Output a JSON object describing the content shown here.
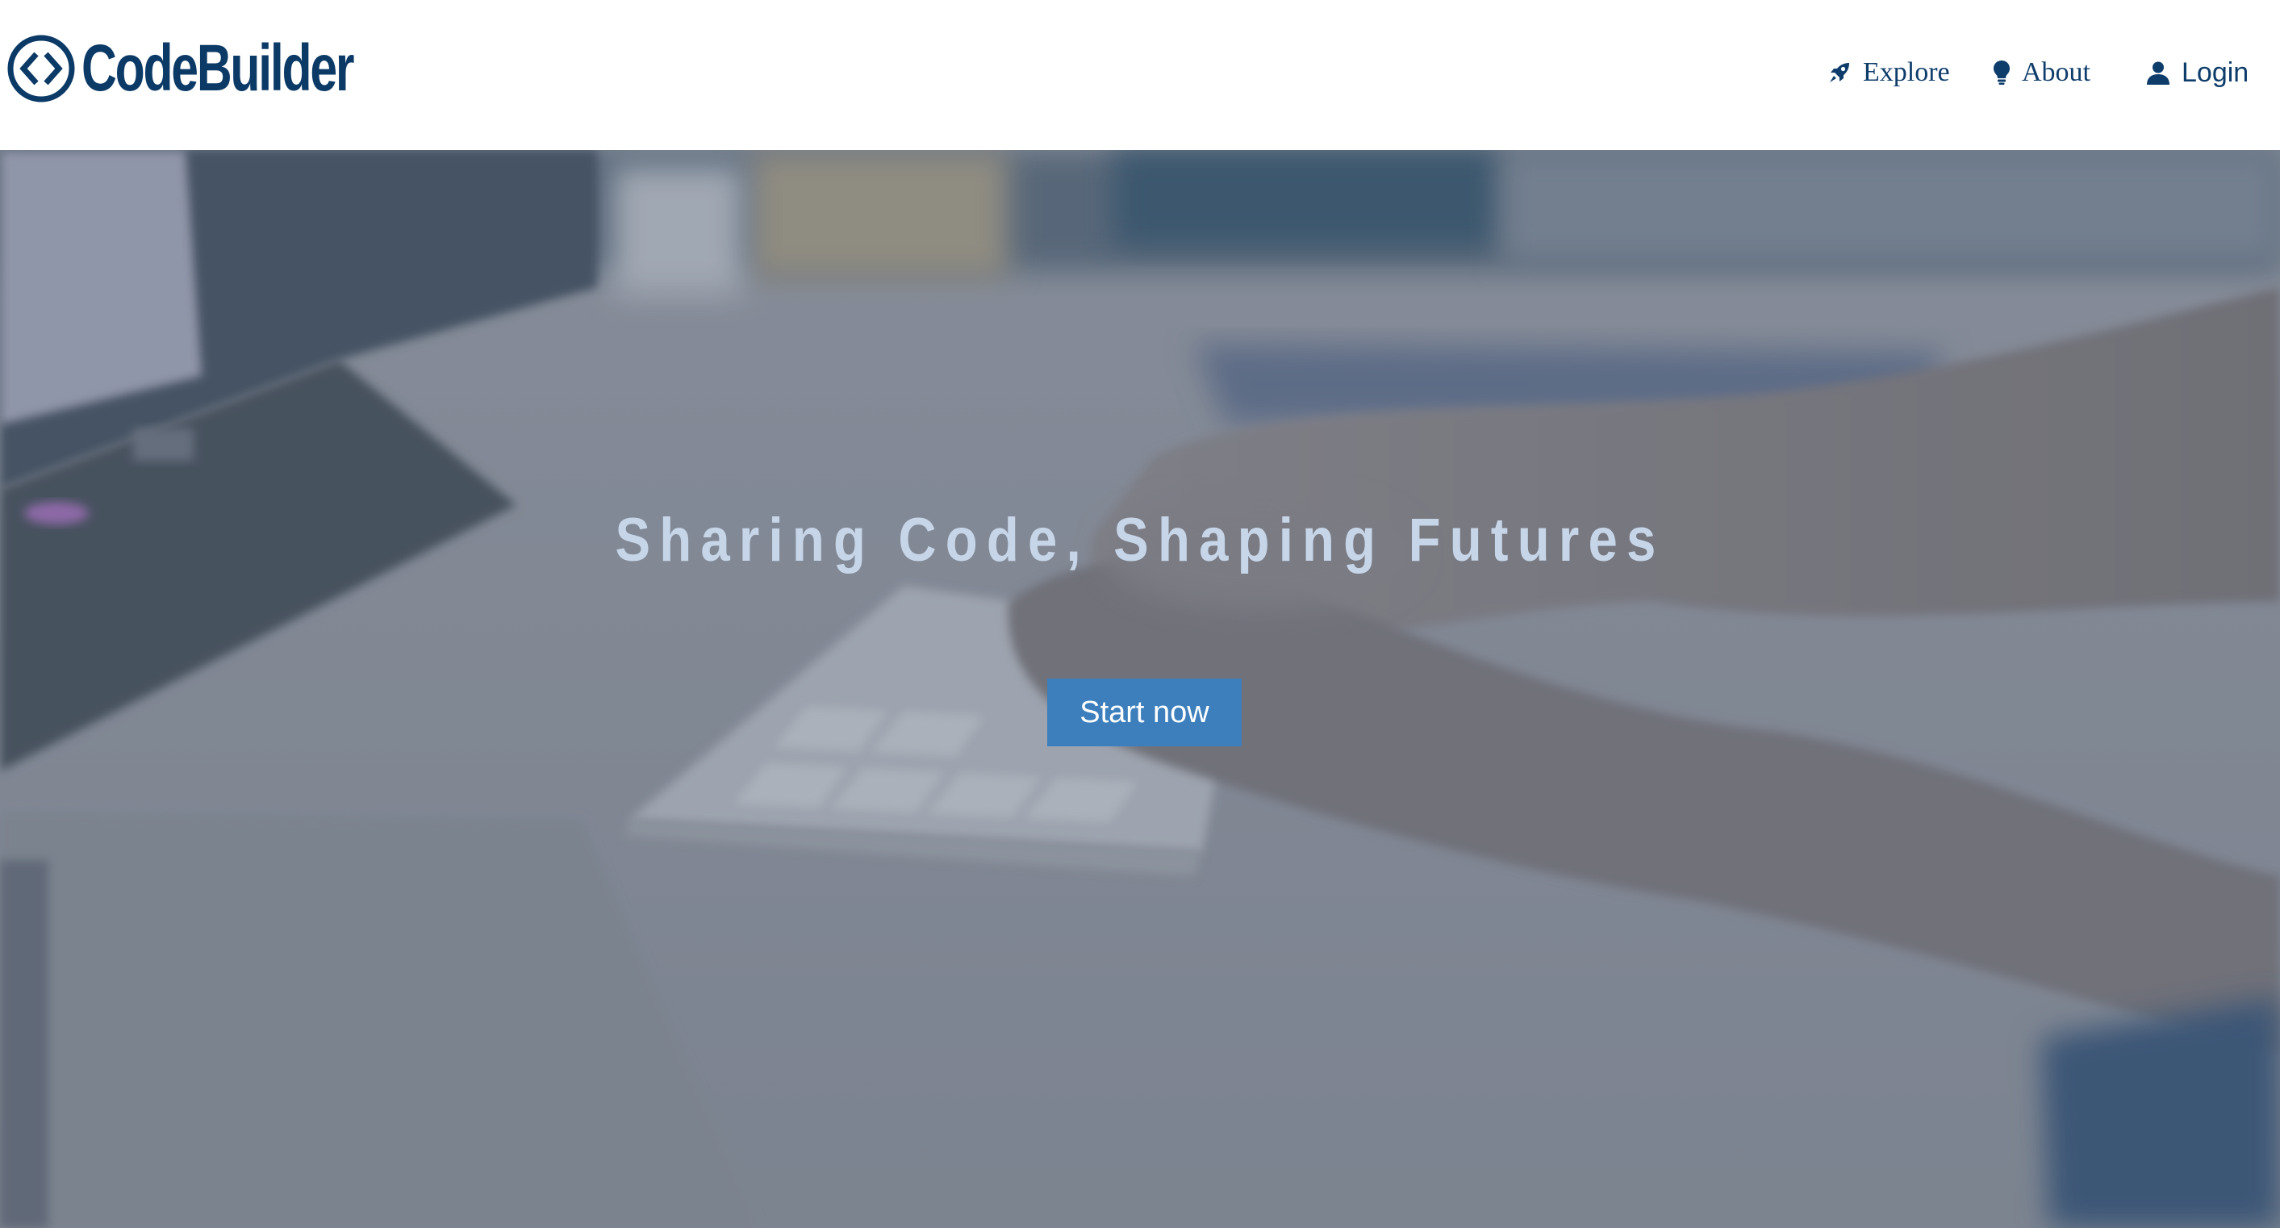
{
  "header": {
    "brand": "CodeBuilder",
    "logo_icon": "code-brackets-circle-icon",
    "brand_color": "#0b3a66",
    "nav": [
      {
        "label": "Explore",
        "icon": "rocket-icon"
      },
      {
        "label": "About",
        "icon": "lightbulb-icon"
      },
      {
        "label": "Login",
        "icon": "user-icon"
      }
    ]
  },
  "hero": {
    "background": "blurred photo of hands typing on a keyboard at a desk",
    "title": "Sharing Code, Shaping Futures",
    "cta_label": "Start now",
    "cta_color": "#3d7fbc"
  }
}
